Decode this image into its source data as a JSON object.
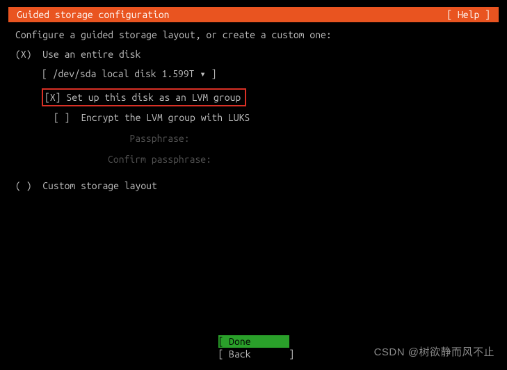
{
  "header": {
    "title": "Guided storage configuration",
    "help": "[ Help ]"
  },
  "instruction": "Configure a guided storage layout, or create a custom one:",
  "options": {
    "entire_disk": {
      "marker": "(X)",
      "label": "Use an entire disk"
    },
    "disk_selector": {
      "open": "[ ",
      "value": "/dev/sda local disk 1.599T",
      "arrow": " ▾ ",
      "close": "]"
    },
    "lvm": {
      "marker": "[X]",
      "label": "Set up this disk as an LVM group"
    },
    "encrypt": {
      "marker": "[ ]",
      "label": "Encrypt the LVM group with LUKS"
    },
    "passphrase_label": "Passphrase:",
    "confirm_label": "Confirm passphrase:",
    "custom": {
      "marker": "( )",
      "label": "Custom storage layout"
    }
  },
  "buttons": {
    "done": "[ Done       ]",
    "back": "[ Back       ]"
  },
  "watermark": "CSDN @树欲静而风不止"
}
